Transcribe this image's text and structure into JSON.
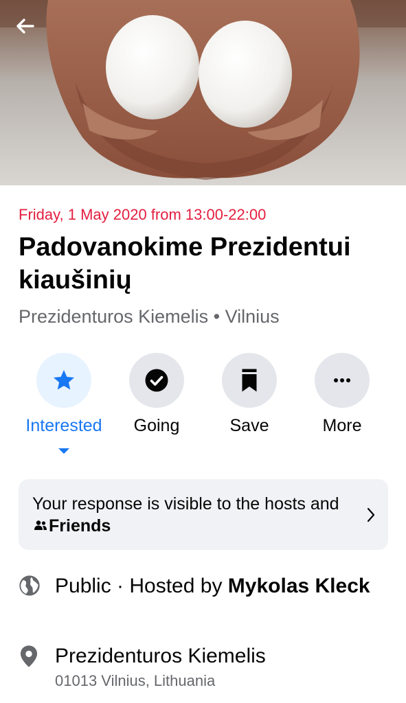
{
  "event": {
    "date_time": "Friday, 1 May 2020 from 13:00-22:00",
    "title": "Padovanokime Prezidentui kiaušinių",
    "subtitle": "Prezidenturos Kiemelis • Vilnius"
  },
  "actions": [
    {
      "label": "Interested",
      "icon": "star-icon",
      "active": true
    },
    {
      "label": "Going",
      "icon": "check-circle-icon",
      "active": false
    },
    {
      "label": "Save",
      "icon": "bookmark-icon",
      "active": false
    },
    {
      "label": "More",
      "icon": "more-dots-icon",
      "active": false
    }
  ],
  "notice": {
    "text_before": "Your response is visible to the hosts and",
    "friends_label": "Friends"
  },
  "details": {
    "privacy": "Public · Hosted by",
    "host": "Mykolas Kleck",
    "location_name": "Prezidenturos Kiemelis",
    "location_address": "01013 Vilnius, Lithuania"
  },
  "colors": {
    "accent": "#1877f2",
    "date_red": "#e41e3f",
    "secondary_text": "#65676b"
  }
}
